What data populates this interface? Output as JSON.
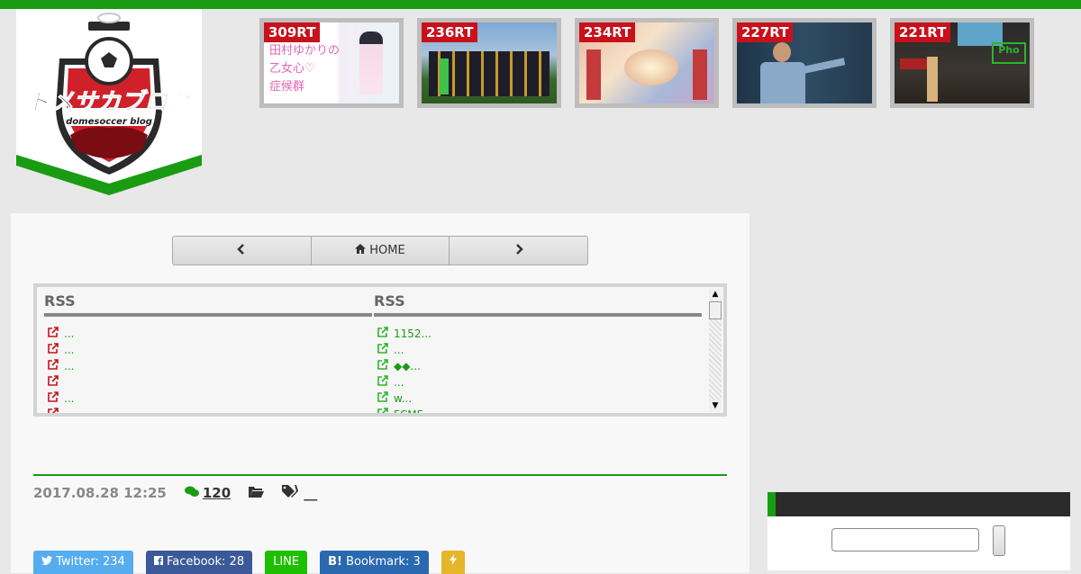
{
  "colors": {
    "brand_green": "#1a9c12",
    "rt_red": "#c8111b"
  },
  "logo": {
    "title": "ドメサカブログ",
    "subtitle": "domesoccer blog"
  },
  "thumbnails": [
    {
      "rt": "309RT",
      "caption": "田村ゆかりの\n乙女心♡\n症候群"
    },
    {
      "rt": "236RT"
    },
    {
      "rt": "234RT"
    },
    {
      "rt": "227RT"
    },
    {
      "rt": "221RT"
    }
  ],
  "pager": {
    "prev_icon": "chevron-left-icon",
    "home_label": "HOME",
    "next_icon": "chevron-right-icon"
  },
  "rss": {
    "left": {
      "header": "RSS",
      "items": [
        "...",
        "...",
        "...",
        "",
        "...",
        ""
      ]
    },
    "right": {
      "header": "RSS",
      "items": [
        "1152...",
        "...",
        "◆◆...",
        "...",
        "  w...",
        "FCMF..."
      ]
    }
  },
  "meta": {
    "date": "2017.08.28 12:25",
    "comments": "120",
    "tags": "__"
  },
  "share": {
    "twitter": "Twitter: 234",
    "facebook": "Facebook: 28",
    "line": "LINE",
    "hatena": "Bookmark: 3",
    "feedly_icon": "bolt-icon"
  }
}
